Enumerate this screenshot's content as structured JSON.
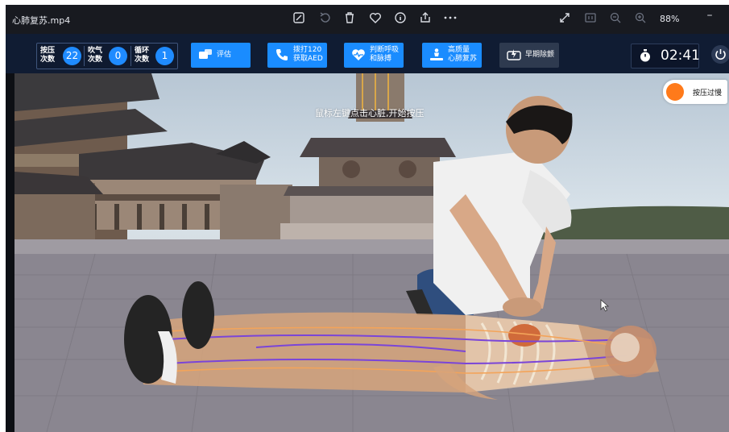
{
  "viewer": {
    "file_name": "心肺复苏.mp4",
    "zoom": "88%",
    "icons": [
      "edit-icon",
      "rotate-icon",
      "delete-icon",
      "favorite-icon",
      "info-icon",
      "share-icon",
      "more-icon",
      "expand-icon",
      "fit-icon",
      "zoom-out-icon",
      "zoom-in-icon",
      "minimize-icon"
    ]
  },
  "counters": [
    {
      "label": "按压次数",
      "value": "22"
    },
    {
      "label": "吹气次数",
      "value": "0"
    },
    {
      "label": "循环次数",
      "value": "1"
    }
  ],
  "buttons": [
    {
      "id": "evaluate",
      "line1": "评估",
      "line2": "",
      "icon": "evaluate-icon"
    },
    {
      "id": "call",
      "line1": "拨打120",
      "line2": "获取AED",
      "icon": "phone-icon"
    },
    {
      "id": "check",
      "line1": "判断呼吸",
      "line2": "和脉搏",
      "icon": "heart-pulse-icon"
    },
    {
      "id": "cpr",
      "line1": "高质量",
      "line2": "心肺复苏",
      "icon": "cpr-icon"
    },
    {
      "id": "defib",
      "line1": "早期除颤",
      "line2": "",
      "icon": "defibrillator-icon"
    }
  ],
  "timer": {
    "value": "02:41",
    "icon": "stopwatch-icon"
  },
  "scene": {
    "hint": "鼠标左键点击心脏,开始按压",
    "speed_label": "按压过慢",
    "speed_color": "#ff7a1a"
  },
  "colors": {
    "accent": "#1a8cff",
    "toolbar_bg": "#101c33",
    "counter_badge": "#1f8bff"
  }
}
